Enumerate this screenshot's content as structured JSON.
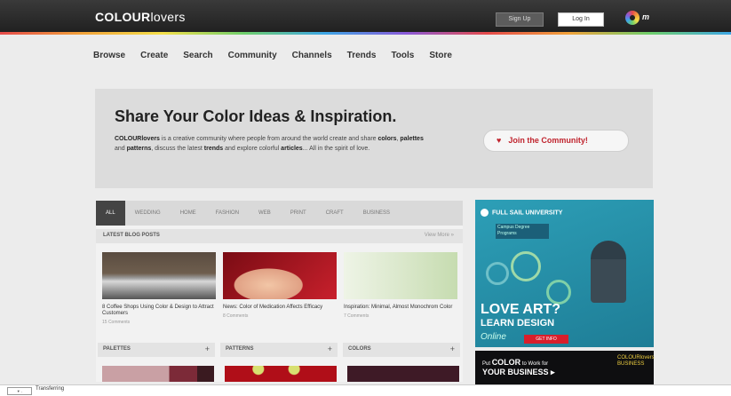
{
  "header": {
    "logo_bold": "COLOUR",
    "logo_thin": "lovers",
    "signup_label": "Sign Up",
    "login_label": "Log In",
    "brand_mark_text": "m"
  },
  "nav": [
    "Browse",
    "Create",
    "Search",
    "Community",
    "Channels",
    "Trends",
    "Tools",
    "Store"
  ],
  "hero": {
    "title": "Share Your Color Ideas & Inspiration.",
    "text_brand": "COLOURlovers",
    "text_a": " is a creative community where people from around the world create and share ",
    "colors": "colors",
    "sep1": ", ",
    "palettes": "palettes",
    "and": " and ",
    "patterns": "patterns",
    "text_b": ", discuss the latest ",
    "trends": "trends",
    "text_c": " and explore colorful ",
    "articles": "articles",
    "text_d": "... All in the spirit of love.",
    "join_label": "Join the Community!"
  },
  "tabs": [
    "ALL",
    "WEDDING",
    "HOME",
    "FASHION",
    "WEB",
    "PRINT",
    "CRAFT",
    "BUSINESS"
  ],
  "latest": {
    "title": "LATEST BLOG POSTS",
    "more": "View More »",
    "posts": [
      {
        "caption": "8 Coffee Shops Using Color & Design to Attract Customers",
        "meta": "15 Comments",
        "color": "#4a4038"
      },
      {
        "caption": "News: Color of Medication Affects Efficacy",
        "meta": "8 Comments",
        "color": "#b01822"
      },
      {
        "caption": "Inspiration: Minimal, Almost Monochrom Color",
        "meta": "7 Comments",
        "color": "#e2ecd8"
      }
    ]
  },
  "categories": [
    {
      "label": "PALETTES",
      "plus": "+"
    },
    {
      "label": "PATTERNS",
      "plus": "+"
    },
    {
      "label": "COLORS",
      "plus": "+"
    }
  ],
  "ad": {
    "brand": "FULL SAIL UNIVERSITY",
    "sub": "Campus Degree Programs",
    "big1": "LOVE ART?",
    "big2": "LEARN DESIGN",
    "online": "Online",
    "cta": "GET INFO"
  },
  "ad2": {
    "line1_small": "Put ",
    "line1": "COLOR",
    "line1_small2": " to Work for",
    "line2": "YOUR BUSINESS ▸",
    "right1": "COLOURlovers",
    "right2": "BUSINESS"
  },
  "status": {
    "icon_label": "▼ -",
    "text": "Transferring"
  }
}
